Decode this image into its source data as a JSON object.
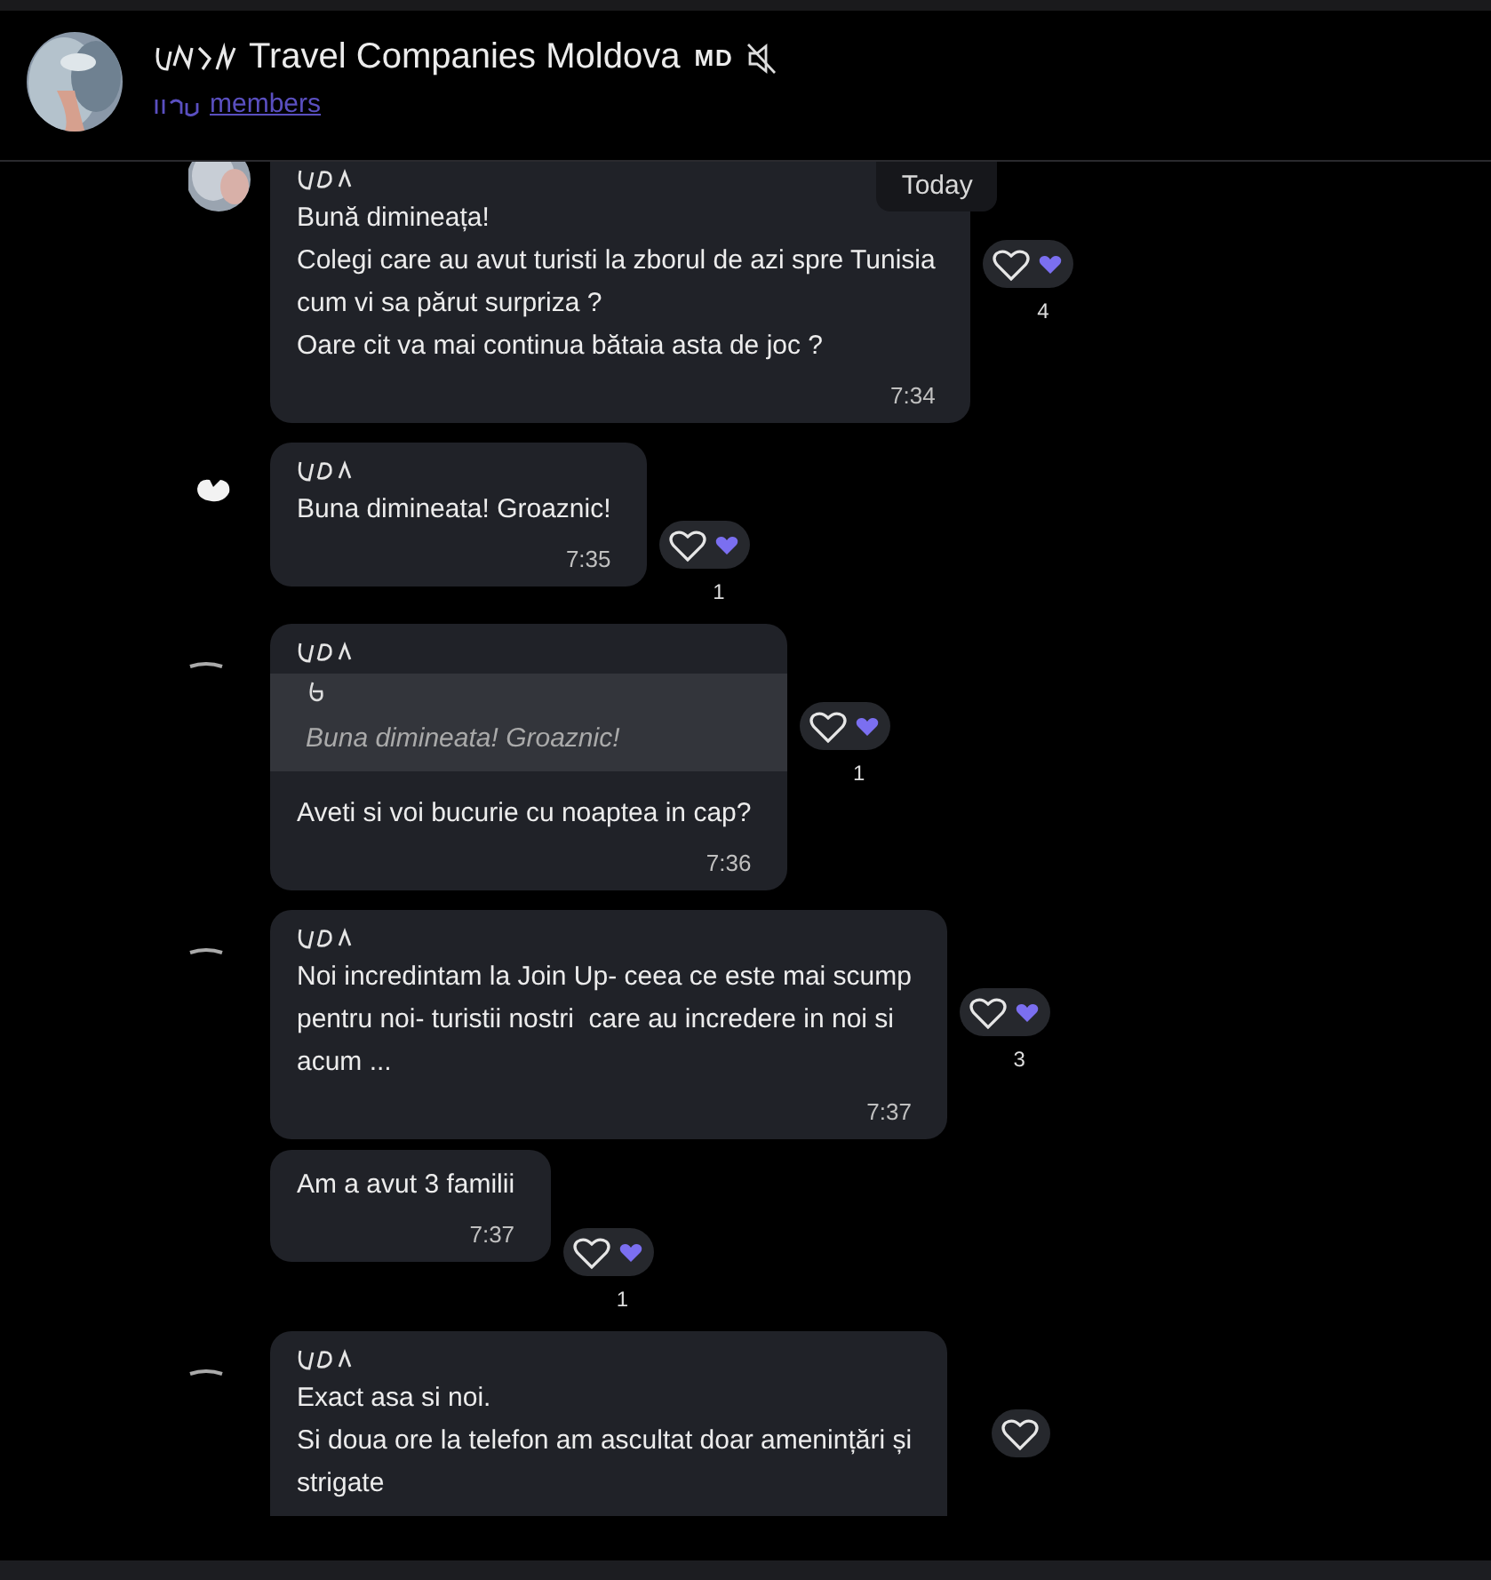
{
  "header": {
    "title": "Travel Companies Moldova",
    "title_suffix": "MD",
    "muted": true,
    "subtitle": "members"
  },
  "date_badge": "Today",
  "messages": [
    {
      "sender_scribbled": true,
      "lines": [
        "Bună dimineața!",
        "Colegi care au avut turisti la zborul de azi spre Tunisia",
        "cum vi sa părut surpriza ?",
        "Oare cit va mai continua bătaia asta de joc ?"
      ],
      "time": "7:34",
      "reaction": {
        "reacted": true,
        "count": "4"
      }
    },
    {
      "avatar": {
        "kind": "blob"
      },
      "sender_scribbled": true,
      "lines": [
        "Buna dimineata! Groaznic!"
      ],
      "time": "7:35",
      "reaction": {
        "reacted": true,
        "count": "1"
      }
    },
    {
      "avatar": {
        "kind": "dash"
      },
      "sender_scribbled": true,
      "quote": {
        "text": "Buna dimineata! Groaznic!"
      },
      "lines": [
        "Aveti si voi bucurie cu noaptea in cap?"
      ],
      "time": "7:36",
      "reaction": {
        "reacted": true,
        "count": "1"
      }
    },
    {
      "avatar": {
        "kind": "dash"
      },
      "sender_scribbled": true,
      "lines": [
        "Noi incredintam la Join Up- ceea ce este mai scump",
        "pentru noi- turistii nostri  care au incredere in noi si",
        "acum ..."
      ],
      "time": "7:37",
      "reaction": {
        "reacted": true,
        "count": "3"
      }
    },
    {
      "sender_scribbled": false,
      "lines": [
        "Am a avut 3 familii"
      ],
      "time": "7:37",
      "reaction": {
        "reacted": true,
        "count": "1"
      }
    },
    {
      "avatar": {
        "kind": "dash"
      },
      "sender_scribbled": true,
      "lines": [
        "Exact asa si noi.",
        "Si doua ore la telefon am ascultat doar amenințări și",
        "strigate"
      ],
      "reaction": {
        "reacted": false
      }
    }
  ]
}
